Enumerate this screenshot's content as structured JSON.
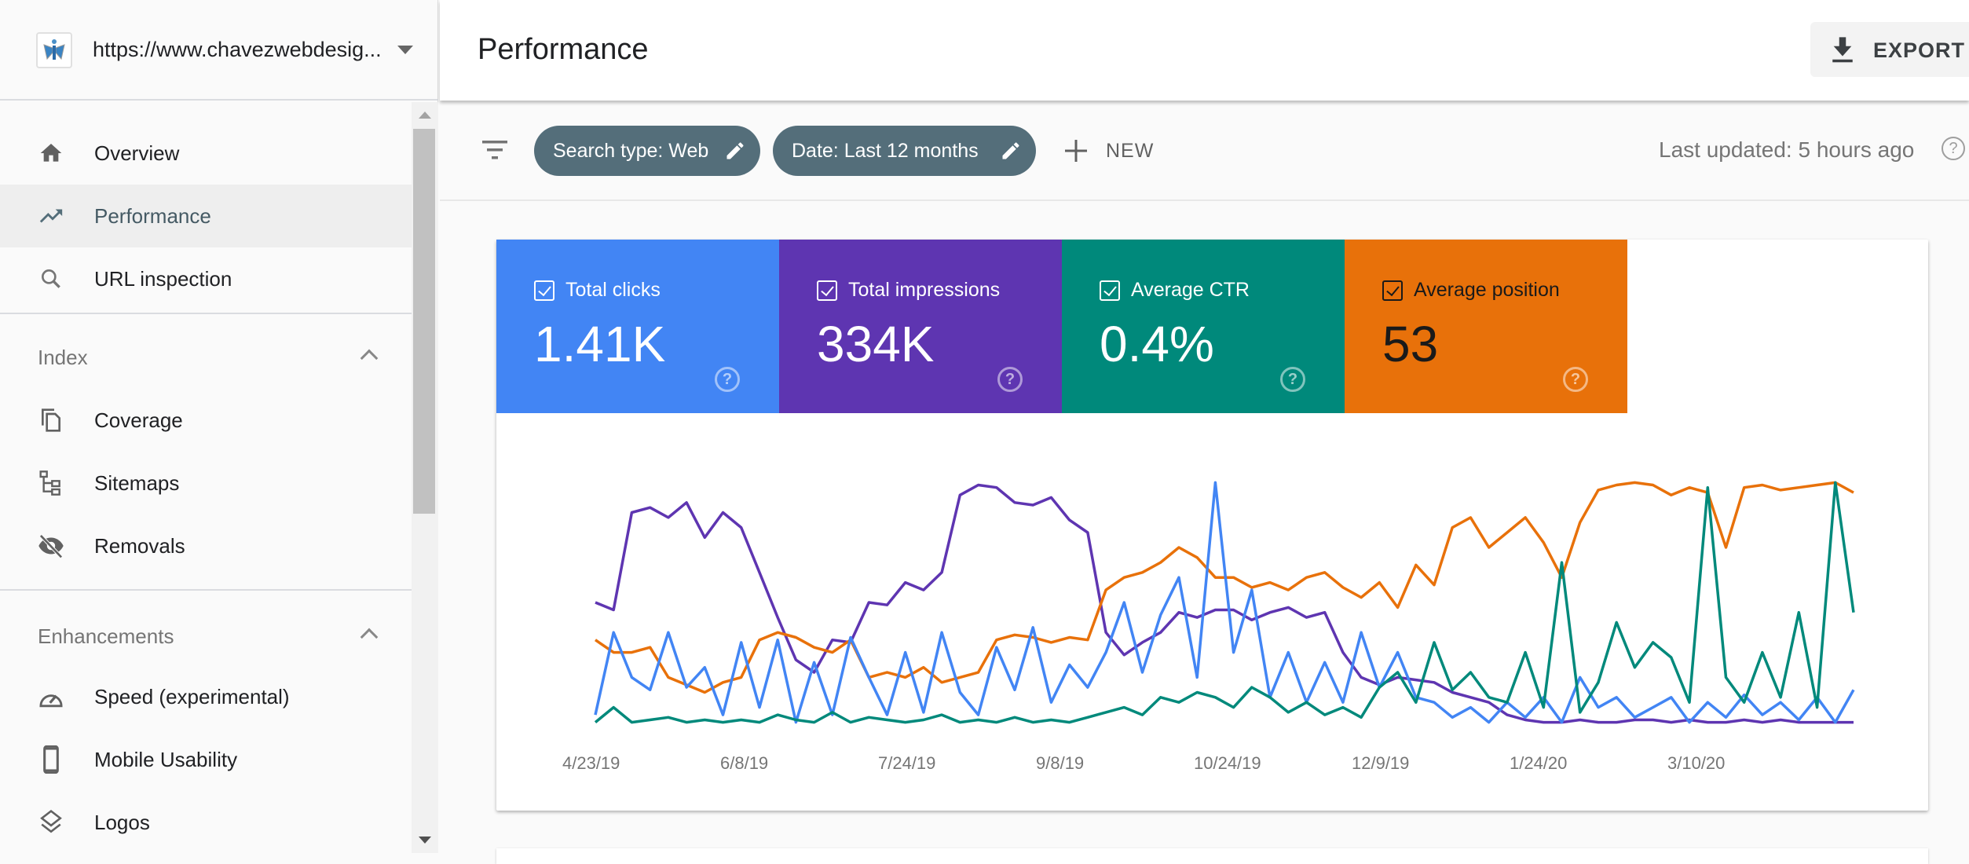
{
  "property": {
    "url": "https://www.chavezwebdesig...",
    "logo_icon": "butterfly-logo-icon",
    "dropdown_icon": "caret-down-icon"
  },
  "sidebar": {
    "items_top": [
      {
        "label": "Overview",
        "icon": "home-icon",
        "active": false
      },
      {
        "label": "Performance",
        "icon": "trending-up-icon",
        "active": true
      },
      {
        "label": "URL inspection",
        "icon": "search-icon",
        "active": false
      }
    ],
    "sections": [
      {
        "label": "Index",
        "expanded": true,
        "items": [
          {
            "label": "Coverage",
            "icon": "file-copy-icon"
          },
          {
            "label": "Sitemaps",
            "icon": "sitemap-icon"
          },
          {
            "label": "Removals",
            "icon": "visibility-off-icon"
          }
        ]
      },
      {
        "label": "Enhancements",
        "expanded": true,
        "items": [
          {
            "label": "Speed (experimental)",
            "icon": "speedometer-icon"
          },
          {
            "label": "Mobile Usability",
            "icon": "smartphone-icon"
          },
          {
            "label": "Logos",
            "icon": "layers-icon"
          }
        ]
      }
    ]
  },
  "header": {
    "title": "Performance",
    "export_label": "EXPORT"
  },
  "filters": {
    "chips": [
      {
        "label": "Search type: Web"
      },
      {
        "label": "Date: Last 12 months"
      }
    ],
    "new_label": "NEW",
    "last_updated": "Last updated: 5 hours ago",
    "help_glyph": "?"
  },
  "metrics": [
    {
      "label": "Total clicks",
      "value": "1.41K",
      "checked": true,
      "color": "#4285f4"
    },
    {
      "label": "Total impressions",
      "value": "334K",
      "checked": true,
      "color": "#5e35b1"
    },
    {
      "label": "Average CTR",
      "value": "0.4%",
      "checked": true,
      "color": "#00897b"
    },
    {
      "label": "Average position",
      "value": "53",
      "checked": true,
      "color": "#e8710a"
    }
  ],
  "chart_data": {
    "type": "line",
    "title": "",
    "xlabel": "",
    "ylabel": "",
    "note": "Each series is plotted on its own independent y-scale (no y tick labels shown); values are normalized 0-1 relative heights",
    "x_tick_labels": [
      "4/23/19",
      "6/8/19",
      "7/24/19",
      "9/8/19",
      "10/24/19",
      "12/9/19",
      "1/24/20",
      "3/10/20"
    ],
    "x_range": [
      "4/23/19",
      "4/21/20"
    ],
    "grid": false,
    "legend": "none",
    "series": [
      {
        "name": "Total impressions",
        "color": "#5e35b1",
        "values": [
          0.5,
          0.47,
          0.86,
          0.88,
          0.84,
          0.9,
          0.76,
          0.86,
          0.8,
          0.62,
          0.44,
          0.27,
          0.22,
          0.35,
          0.34,
          0.5,
          0.49,
          0.58,
          0.55,
          0.62,
          0.93,
          0.97,
          0.96,
          0.9,
          0.89,
          0.92,
          0.83,
          0.78,
          0.38,
          0.29,
          0.34,
          0.38,
          0.46,
          0.44,
          0.47,
          0.47,
          0.43,
          0.46,
          0.48,
          0.44,
          0.46,
          0.3,
          0.2,
          0.17,
          0.2,
          0.19,
          0.18,
          0.14,
          0.12,
          0.1,
          0.05,
          0.03,
          0.02,
          0.02,
          0.03,
          0.02,
          0.02,
          0.03,
          0.03,
          0.02,
          0.03,
          0.02,
          0.02,
          0.03,
          0.02,
          0.03,
          0.02,
          0.02,
          0.02,
          0.02
        ]
      },
      {
        "name": "Average position",
        "color": "#e8710a",
        "values": [
          0.35,
          0.3,
          0.3,
          0.32,
          0.2,
          0.17,
          0.14,
          0.18,
          0.2,
          0.35,
          0.38,
          0.36,
          0.32,
          0.3,
          0.35,
          0.2,
          0.22,
          0.2,
          0.24,
          0.18,
          0.2,
          0.22,
          0.35,
          0.37,
          0.36,
          0.34,
          0.36,
          0.35,
          0.55,
          0.6,
          0.62,
          0.66,
          0.72,
          0.68,
          0.6,
          0.6,
          0.56,
          0.58,
          0.55,
          0.6,
          0.62,
          0.56,
          0.52,
          0.58,
          0.48,
          0.65,
          0.57,
          0.8,
          0.84,
          0.72,
          0.78,
          0.84,
          0.74,
          0.6,
          0.82,
          0.95,
          0.97,
          0.98,
          0.97,
          0.93,
          0.96,
          0.94,
          0.72,
          0.96,
          0.97,
          0.95,
          0.96,
          0.97,
          0.98,
          0.94
        ]
      },
      {
        "name": "Total clicks",
        "color": "#4285f4",
        "values": [
          0.05,
          0.38,
          0.2,
          0.15,
          0.38,
          0.16,
          0.24,
          0.05,
          0.34,
          0.08,
          0.35,
          0.02,
          0.26,
          0.05,
          0.36,
          0.2,
          0.05,
          0.3,
          0.06,
          0.38,
          0.14,
          0.05,
          0.32,
          0.15,
          0.4,
          0.1,
          0.25,
          0.16,
          0.3,
          0.5,
          0.22,
          0.45,
          0.6,
          0.2,
          0.98,
          0.3,
          0.55,
          0.12,
          0.3,
          0.1,
          0.26,
          0.1,
          0.38,
          0.16,
          0.3,
          0.12,
          0.1,
          0.04,
          0.08,
          0.02,
          0.1,
          0.04,
          0.12,
          0.02,
          0.2,
          0.08,
          0.12,
          0.04,
          0.08,
          0.12,
          0.02,
          0.1,
          0.04,
          0.13,
          0.05,
          0.1,
          0.03,
          0.12,
          0.02,
          0.15
        ]
      },
      {
        "name": "Average CTR",
        "color": "#00897b",
        "values": [
          0.02,
          0.08,
          0.02,
          0.03,
          0.04,
          0.02,
          0.03,
          0.02,
          0.03,
          0.02,
          0.05,
          0.03,
          0.02,
          0.06,
          0.02,
          0.04,
          0.03,
          0.02,
          0.03,
          0.05,
          0.02,
          0.03,
          0.02,
          0.04,
          0.02,
          0.03,
          0.02,
          0.04,
          0.06,
          0.08,
          0.05,
          0.12,
          0.1,
          0.14,
          0.12,
          0.08,
          0.16,
          0.12,
          0.06,
          0.1,
          0.05,
          0.08,
          0.04,
          0.16,
          0.22,
          0.1,
          0.34,
          0.15,
          0.22,
          0.12,
          0.1,
          0.3,
          0.08,
          0.66,
          0.06,
          0.18,
          0.42,
          0.24,
          0.34,
          0.28,
          0.1,
          0.96,
          0.2,
          0.1,
          0.3,
          0.12,
          0.46,
          0.08,
          0.98,
          0.46
        ]
      }
    ]
  }
}
